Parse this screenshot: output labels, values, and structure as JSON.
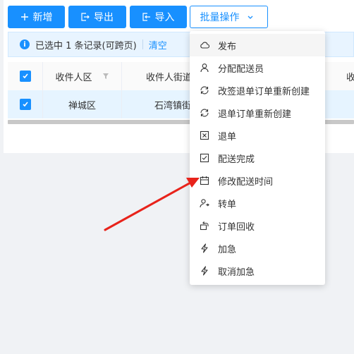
{
  "toolbar": {
    "add_label": "新增",
    "export_label": "导出",
    "import_label": "导入",
    "batch_label": "批量操作"
  },
  "alert": {
    "message": "已选中 1 条记录(可跨页)",
    "clear_label": "清空"
  },
  "table": {
    "columns": [
      "收件人区",
      "收件人街道",
      "收"
    ],
    "rows": [
      {
        "district": "禅城区",
        "street": "石湾镇街"
      }
    ]
  },
  "menu": {
    "items": [
      {
        "label": "发布",
        "icon": "cloud-icon"
      },
      {
        "label": "分配配送员",
        "icon": "user-icon"
      },
      {
        "label": "改签退单订单重新创建",
        "icon": "refresh-icon"
      },
      {
        "label": "退单订单重新创建",
        "icon": "refresh-icon"
      },
      {
        "label": "退单",
        "icon": "close-square-icon"
      },
      {
        "label": "配送完成",
        "icon": "check-square-icon"
      },
      {
        "label": "修改配送时间",
        "icon": "calendar-icon"
      },
      {
        "label": "转单",
        "icon": "user-transfer-icon"
      },
      {
        "label": "订单回收",
        "icon": "rotate-icon"
      },
      {
        "label": "加急",
        "icon": "lightning-icon"
      },
      {
        "label": "取消加急",
        "icon": "lightning-icon"
      }
    ]
  },
  "colors": {
    "primary": "#1890ff",
    "selected_row": "#e6f4ff",
    "arrow": "#e8231b"
  }
}
